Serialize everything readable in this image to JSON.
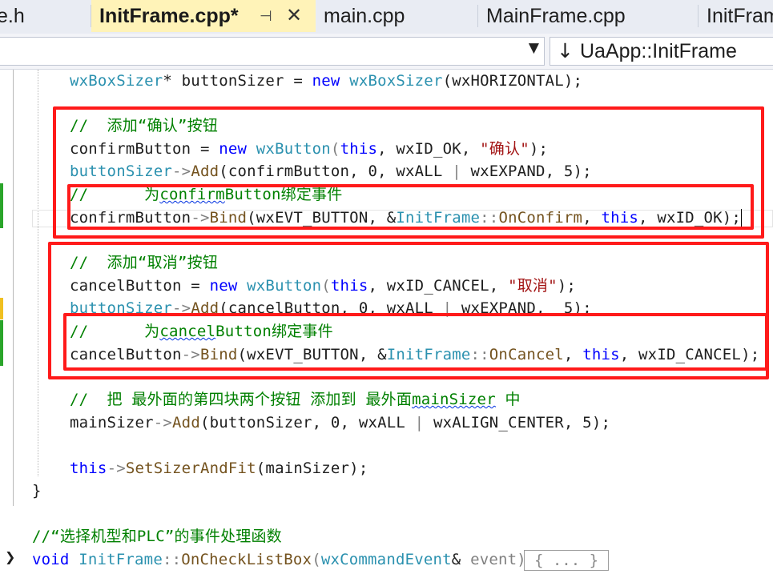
{
  "tabs": [
    {
      "label": "e.h"
    },
    {
      "label": "InitFrame.cpp*"
    },
    {
      "label": "main.cpp"
    },
    {
      "label": "MainFrame.cpp"
    },
    {
      "label": "InitFram"
    }
  ],
  "tab_pin_glyph": "⊣",
  "tab_close_glyph": "✕",
  "nav": {
    "scope_dropdown_value": "",
    "member_arrow": "↓",
    "member_value": "UaApp::InitFrame"
  },
  "code": {
    "l1": {
      "a": "wxBoxSizer",
      "b": "* buttonSizer = ",
      "c": "new",
      "d": " ",
      "e": "wxBoxSizer",
      "f": "(wxHORIZONTAL);"
    },
    "l2": {
      "a": "//  添加“确认”按钮"
    },
    "l3": {
      "a": "confirmButton = ",
      "b": "new",
      "c": " ",
      "d": "wxButton",
      "e": "(",
      "f": "this",
      "g": ", wxID_OK, ",
      "h": "\"确认\"",
      "i": ");"
    },
    "l4": {
      "a": "buttonSizer",
      "b": "->",
      "c": "Add",
      "d": "(confirmButton, 0, wxALL ",
      "e": "|",
      "f": " wxEXPAND, 5);"
    },
    "l5": {
      "a": "//      为",
      "b": "confirm",
      "c": "Button绑定事件"
    },
    "l6": {
      "a": "confirmButton",
      "b": "->",
      "c": "Bind",
      "d": "(wxEVT_BUTTON, &",
      "e": "InitFrame",
      "f": "::",
      "g": "OnConfirm",
      "h": ", ",
      "i": "this",
      "j": ", wxID_OK);"
    },
    "l7": {
      "a": "//  添加“取消”按钮"
    },
    "l8": {
      "a": "cancelButton = ",
      "b": "new",
      "c": " ",
      "d": "wxButton",
      "e": "(",
      "f": "this",
      "g": ", wxID_CANCEL, ",
      "h": "\"取消\"",
      "i": ");"
    },
    "l9": {
      "a": "buttonSizer",
      "b": "->",
      "c": "Add",
      "d": "(cancelButton, 0, wxALL ",
      "e": "|",
      "f": " wxEXPAND,  5);"
    },
    "l10": {
      "a": "//      为",
      "b": "cancel",
      "c": "Button绑定事件"
    },
    "l11": {
      "a": "cancelButton",
      "b": "->",
      "c": "Bind",
      "d": "(wxEVT_BUTTON, &",
      "e": "InitFrame",
      "f": "::",
      "g": "OnCancel",
      "h": ", ",
      "i": "this",
      "j": ", wxID_CANCEL);"
    },
    "l12": {
      "a": "//  把 最外面的第四块两个按钮 添加到 最外面",
      "b": "mainSizer",
      "c": " 中"
    },
    "l13": {
      "a": "mainSizer",
      "b": "->",
      "c": "Add",
      "d": "(buttonSizer, 0, wxALL ",
      "e": "|",
      "f": " wxALIGN_CENTER, 5);"
    },
    "l14": {
      "a": "this",
      "b": "->",
      "c": "SetSizerAndFit",
      "d": "(mainSizer);"
    },
    "l15": {
      "a": "}"
    },
    "l16": {
      "a": "//“选择机型和PLC”的事件处理函数"
    },
    "l17": {
      "a": "void",
      "b": " ",
      "c": "InitFrame",
      "d": "::",
      "e": "OnCheckListBox",
      "f": "(",
      "g": "wxCommandEvent",
      "h": "& ",
      "i": "event",
      "j": ")"
    },
    "collapsed_label": "{ ... }",
    "expander_glyph": "❯"
  },
  "colors": {
    "highlight_box": "#ff1a1a",
    "active_tab": "#fff3b8",
    "keyword": "#0000ff",
    "type": "#2b91af",
    "comment": "#008000",
    "string": "#a31515",
    "function": "#74531f",
    "change_marker_saved": "#2aa52a",
    "change_marker_unsaved": "#f0c020"
  }
}
